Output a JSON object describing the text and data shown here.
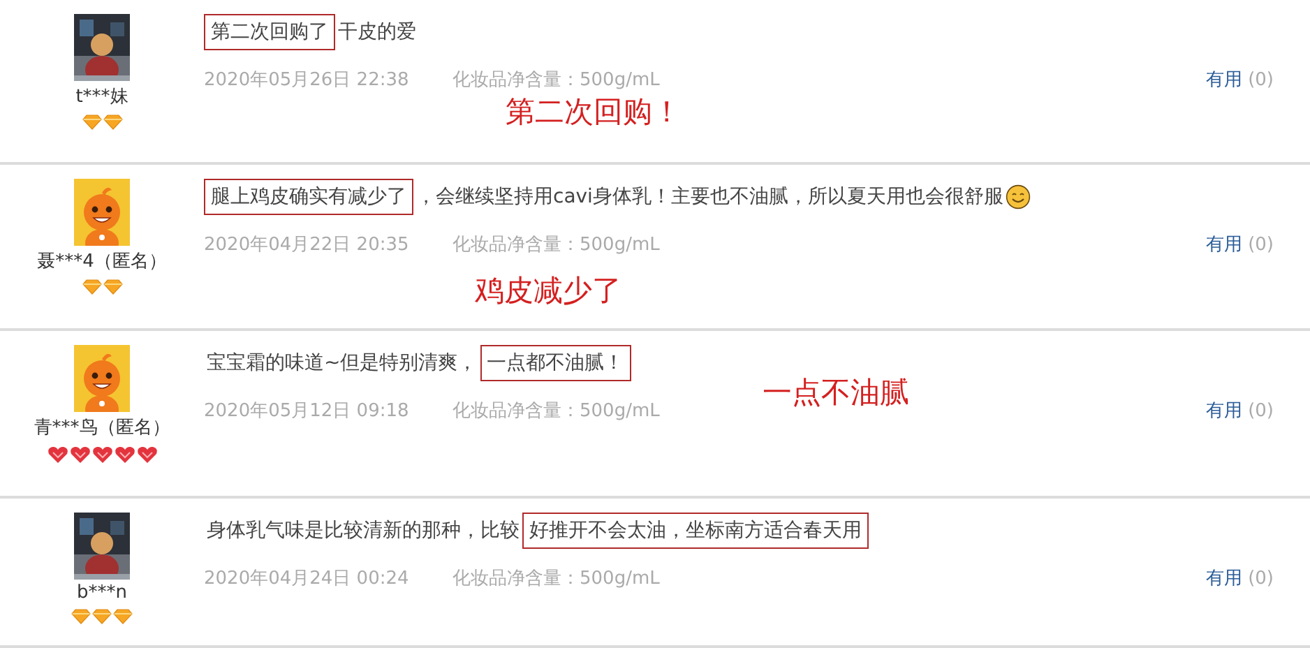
{
  "reviews": [
    {
      "avatar": {
        "kind": "picture"
      },
      "user": "t***妹",
      "badges": [
        {
          "kind": "diamond"
        },
        {
          "kind": "diamond"
        }
      ],
      "comment": [
        {
          "text": "第二次回购了",
          "highlighted": true
        },
        {
          "text": "干皮的爱",
          "highlighted": false
        }
      ],
      "emoji": false,
      "date": "2020年05月26日 22:38",
      "spec": "化妆品净含量：500g/mL",
      "useful": {
        "label": "有用",
        "count": "(0)"
      },
      "annotation": "第二次回购！"
    },
    {
      "avatar": {
        "kind": "mascot"
      },
      "user": "聂***4（匿名）",
      "badges": [
        {
          "kind": "diamond"
        },
        {
          "kind": "diamond"
        }
      ],
      "comment": [
        {
          "text": "腿上鸡皮确实有减少了",
          "highlighted": true
        },
        {
          "text": "，会继续坚持用cavi身体乳！主要也不油腻，所以夏天用也会很舒服",
          "highlighted": false
        }
      ],
      "emoji": true,
      "date": "2020年04月22日 20:35",
      "spec": "化妆品净含量：500g/mL",
      "useful": {
        "label": "有用",
        "count": "(0)"
      },
      "annotation": "鸡皮减少了"
    },
    {
      "avatar": {
        "kind": "mascot"
      },
      "user": "青***鸟（匿名）",
      "badges": [
        {
          "kind": "heart"
        },
        {
          "kind": "heart"
        },
        {
          "kind": "heart"
        },
        {
          "kind": "heart"
        },
        {
          "kind": "heart"
        }
      ],
      "comment": [
        {
          "text": "宝宝霜的味道~但是特别清爽，",
          "highlighted": false
        },
        {
          "text": "一点都不油腻！",
          "highlighted": true
        }
      ],
      "emoji": false,
      "date": "2020年05月12日 09:18",
      "spec": "化妆品净含量：500g/mL",
      "useful": {
        "label": "有用",
        "count": "(0)"
      },
      "annotation": "一点不油腻"
    },
    {
      "avatar": {
        "kind": "picture"
      },
      "user": "b***n",
      "badges": [
        {
          "kind": "diamond"
        },
        {
          "kind": "diamond"
        },
        {
          "kind": "diamond"
        }
      ],
      "comment": [
        {
          "text": "身体乳气味是比较清新的那种，比较",
          "highlighted": false
        },
        {
          "text": "好推开不会太油，坐标南方适合春天用",
          "highlighted": true
        }
      ],
      "emoji": false,
      "date": "2020年04月24日 00:24",
      "spec": "化妆品净含量：500g/mL",
      "useful": {
        "label": "有用",
        "count": "(0)"
      }
    }
  ]
}
